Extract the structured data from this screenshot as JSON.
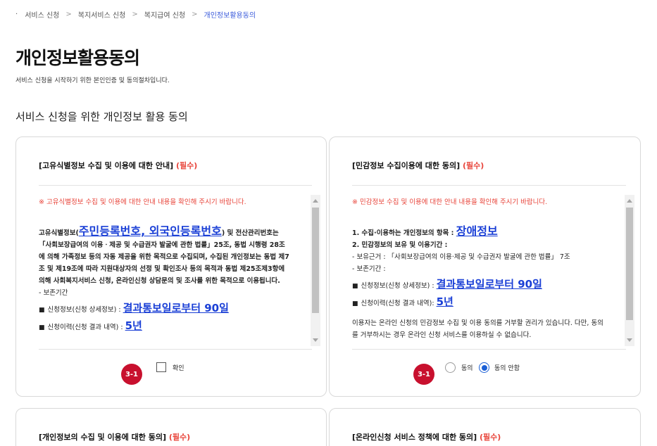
{
  "breadcrumb": {
    "items": [
      "서비스 신청",
      "복지서비스 신청",
      "복지급여 신청"
    ],
    "current": "개인정보활용동의"
  },
  "page": {
    "title": "개인정보활용동의",
    "description": "서비스 신청을 시작하기 위한 본인인증 및 동의절차입니다.",
    "section_title": "서비스 신청을 위한 개인정보 활용 동의"
  },
  "card1": {
    "title": "[고유식별정보 수집 및 이용에 대한 안내]",
    "required": "(필수)",
    "notice": "※ 고유식별정보 수집 및 이용에 대한 안내 내용을 확인해 주시기 바랍니다.",
    "body_prefix": "고유식별정보(",
    "body_highlight": "주민등록번호, 외국인등록번호",
    "body_suffix": ") 및 전산관리번호는「사회보장급여의 이용ㆍ제공 및 수급권자 발굴에 관한 법률」25조, 동법 시행령 28조에 의해 가족정보 등의 자동 제공을 위한 목적으로 수집되며, 수집된 개인정보는 동법 제7조 및 제19조에 따라 지원대상자의 선정 및 확인조사 등의 목적과 동법 제25조제3항에 의해 사회복지서비스 신청, 온라인신청 상담문의 및 조사를 위한 목적으로 이용됩니다.",
    "retention_label": "- 보존기간",
    "item1_label": "신청정보(신청 상세정보) :",
    "item1_value": "결과통보일로부터 90일",
    "item2_label": "신청이력(신청 결과 내역) :",
    "item2_value": "5년",
    "step_badge": "3-1",
    "checkbox_label": "확인"
  },
  "card2": {
    "title": "[민감정보 수집이용에 대한 동의]",
    "required": "(필수)",
    "notice": "※ 민감정보 수집 및 이용에 대한 안내 내용을 확인해 주시기 바랍니다.",
    "line1_label": "1. 수집·이용하는 개인정보의 항목 :",
    "line1_value": "장애정보",
    "line2": "2. 민감정보의 보유 및 이용기간 :",
    "line3": "- 보유근거 : 「사회보장급여의 이용·제공 및 수급권자 발굴에 관한 법률」 7조",
    "line4": "- 보존기간 :",
    "item1_label": "신청정보(신청 상세정보) :",
    "item1_value": "결과통보일로부터 90일",
    "item2_label": "신청이력(신청 결과 내역):",
    "item2_value": "5년",
    "line5": "이용자는 온라인 신청의 민감정보 수집 및 이용 동의를 거부할 권리가 있습니다. 다만, 동의를 거부하시는 경우 온라인 신청 서비스를 이용하실 수 없습니다.",
    "step_badge": "3-1",
    "radio_agree": "동의",
    "radio_disagree": "동의 안함"
  },
  "card3": {
    "title": "[개인정보의 수집 및 이용에 대한 동의]",
    "required": "(필수)"
  },
  "card4": {
    "title": "[온라인신청 서비스 정책에 대한 동의]",
    "required": "(필수)"
  }
}
